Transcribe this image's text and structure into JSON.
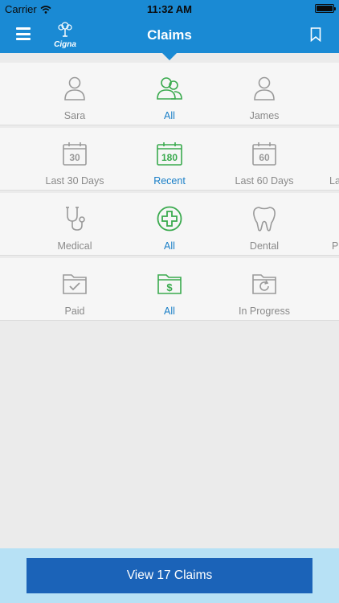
{
  "status_bar": {
    "carrier": "Carrier",
    "time": "11:32 AM"
  },
  "header": {
    "title": "Claims",
    "logo_text": "Cigna"
  },
  "colors": {
    "brand": "#1a8ad4",
    "active": "#3aaa4e",
    "inactive": "#9a9a9a",
    "active_label": "#1a7fc7",
    "cta": "#1b63b8"
  },
  "filters": {
    "members": [
      {
        "label": "Sara",
        "icon": "person-icon",
        "active": false
      },
      {
        "label": "All",
        "icon": "people-icon",
        "active": true
      },
      {
        "label": "James",
        "icon": "person-icon",
        "active": false
      }
    ],
    "periods": [
      {
        "label": "Last 30 Days",
        "icon_text": "30",
        "icon": "calendar-icon",
        "active": false
      },
      {
        "label": "Recent",
        "icon_text": "180",
        "icon": "calendar-icon",
        "active": true
      },
      {
        "label": "Last 60 Days",
        "icon_text": "60",
        "icon": "calendar-icon",
        "active": false
      },
      {
        "label": "La",
        "icon": "calendar-icon",
        "active": false
      }
    ],
    "types": [
      {
        "label": "Medical",
        "icon": "stethoscope-icon",
        "active": false
      },
      {
        "label": "All",
        "icon": "medical-cross-icon",
        "active": true
      },
      {
        "label": "Dental",
        "icon": "tooth-icon",
        "active": false
      },
      {
        "label": "P",
        "icon": "pharmacy-icon",
        "active": false
      }
    ],
    "statuses": [
      {
        "label": "Paid",
        "icon": "folder-check-icon",
        "active": false
      },
      {
        "label": "All",
        "icon": "folder-dollar-icon",
        "active": true
      },
      {
        "label": "In Progress",
        "icon": "folder-refresh-icon",
        "active": false
      }
    ]
  },
  "footer": {
    "button_label": "View 17 Claims"
  }
}
